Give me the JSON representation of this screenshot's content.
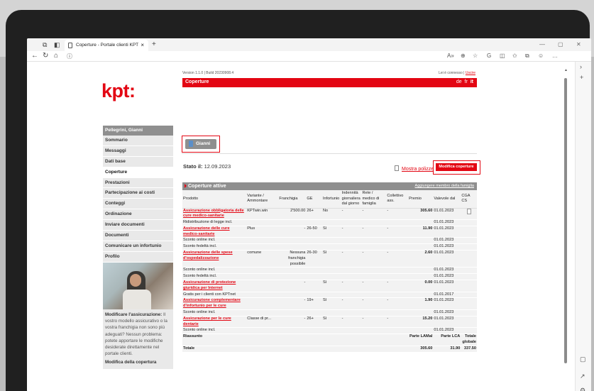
{
  "browser": {
    "tab_title": "Coperture - Portale clienti KPT",
    "tab_close": "×",
    "new_tab": "+",
    "address": ""
  },
  "header": {
    "logo": "kpt:",
    "version": "Version 1.1.0 | Build 20230908.4",
    "logged_in": "Lei è connesso |",
    "logout": "Uscire",
    "page_title": "Coperture",
    "lang_de": "de",
    "lang_fr": "fr",
    "lang_it": "it"
  },
  "sidebar": {
    "user": "Pellegrini, Gianni",
    "items": [
      {
        "label": "Sommario"
      },
      {
        "label": "Messaggi"
      },
      {
        "label": "Dati base"
      },
      {
        "label": "Coperture"
      },
      {
        "label": "Prestazioni"
      },
      {
        "label": "Partecipazione ai costi"
      },
      {
        "label": "Conteggi"
      },
      {
        "label": "Ordinazione"
      },
      {
        "label": "Inviare documenti"
      },
      {
        "label": "Documenti"
      },
      {
        "label": "Comunicare un infortunio"
      },
      {
        "label": "Profilo"
      }
    ],
    "promo_title": "Modificare l'assicurazione:",
    "promo_text": "Il vostro modello assicurativo o la vostra franchigia non sono più adeguati? Nessun problema: potete apportare le modifiche desiderate direttamente nel portale clienti.",
    "promo_link": "Modifica della copertura"
  },
  "main": {
    "person_tab": "Gianni",
    "stato_label": "Stato il:",
    "stato_date": "12.09.2023",
    "mostra_polizze": "Mostra polizze",
    "modifica_button": "Modifica coperture",
    "panel_title": "Coperture attive",
    "add_member": "Aggiungere membro della famiglia"
  },
  "table": {
    "headers": {
      "prodotto": "Prodotto",
      "variante": "Variante / Ammontare",
      "franchigia": "Franchigia",
      "ge": "GE",
      "infortunio": "Infortunio",
      "indennita": "Indennità giornaliera dal giorno",
      "rete": "Rete / medico di famiglia",
      "collettivo": "Collettivo ass.",
      "premio": "Premio",
      "valevole": "Valevole dal",
      "cga": "CGA CS"
    },
    "rows": [
      {
        "prodotto": "Assicurazione obbligatoria delle cure medico-sanitarie",
        "link": true,
        "variante": "KPTwin.win",
        "franchigia": "2'500.00",
        "ge": "26+",
        "infortunio": "No",
        "indennita": "-",
        "rete": "-",
        "collettivo": "-",
        "premio": "305.60",
        "valevole": "01.01.2023",
        "cga": true
      },
      {
        "prodotto": "Ridistribuzione di legge incl.",
        "link": false,
        "variante": "",
        "franchigia": "",
        "ge": "",
        "infortunio": "",
        "indennita": "",
        "rete": "",
        "collettivo": "",
        "premio": "",
        "valevole": "01.01.2023",
        "cga": false
      },
      {
        "prodotto": "Assicurazione delle cure medico-sanitarie",
        "link": true,
        "variante": "Plus",
        "franchigia": "-",
        "ge": "26-50",
        "infortunio": "Sì",
        "indennita": "-",
        "rete": "-",
        "collettivo": "-",
        "premio": "11.90",
        "valevole": "01.01.2023",
        "cga": false
      },
      {
        "prodotto": "Sconto online incl.",
        "link": false,
        "variante": "",
        "franchigia": "",
        "ge": "",
        "infortunio": "",
        "indennita": "",
        "rete": "",
        "collettivo": "",
        "premio": "",
        "valevole": "01.01.2023",
        "cga": false
      },
      {
        "prodotto": "Sconto fedeltà incl.",
        "link": false,
        "variante": "",
        "franchigia": "",
        "ge": "",
        "infortunio": "",
        "indennita": "",
        "rete": "",
        "collettivo": "",
        "premio": "",
        "valevole": "01.01.2023",
        "cga": false
      },
      {
        "prodotto": "Assicurazione delle spese d'ospedalizzazione",
        "link": true,
        "variante": "comune",
        "franchigia": "Nessuna franchigia possibile",
        "ge": "26-30",
        "infortunio": "Sì",
        "indennita": "-",
        "rete": "-",
        "collettivo": "-",
        "premio": "2.60",
        "valevole": "01.01.2023",
        "cga": false
      },
      {
        "prodotto": "Sconto online incl.",
        "link": false,
        "variante": "",
        "franchigia": "",
        "ge": "",
        "infortunio": "",
        "indennita": "",
        "rete": "",
        "collettivo": "",
        "premio": "",
        "valevole": "01.01.2023",
        "cga": false
      },
      {
        "prodotto": "Sconto fedeltà incl.",
        "link": false,
        "variante": "",
        "franchigia": "",
        "ge": "",
        "infortunio": "",
        "indennita": "",
        "rete": "",
        "collettivo": "",
        "premio": "",
        "valevole": "01.01.2023",
        "cga": false
      },
      {
        "prodotto": "Assicurazione di protezione giuridica per Internet",
        "link": true,
        "variante": "",
        "franchigia": "-",
        "ge": "",
        "infortunio": "Sì",
        "indennita": "-",
        "rete": "-",
        "collettivo": "-",
        "premio": "0.00",
        "valevole": "01.01.2023",
        "cga": false
      },
      {
        "prodotto": "Gratis per i clienti con KPTnet",
        "link": false,
        "variante": "",
        "franchigia": "",
        "ge": "",
        "infortunio": "",
        "indennita": "",
        "rete": "",
        "collettivo": "",
        "premio": "",
        "valevole": "01.01.2017",
        "cga": false
      },
      {
        "prodotto": "Assicurazione complementare d'infortunio per le cure",
        "link": true,
        "variante": "",
        "franchigia": "-",
        "ge": "19+",
        "infortunio": "Sì",
        "indennita": "-",
        "rete": "-",
        "collettivo": "-",
        "premio": "1.90",
        "valevole": "01.01.2023",
        "cga": false
      },
      {
        "prodotto": "Sconto online incl.",
        "link": false,
        "variante": "",
        "franchigia": "",
        "ge": "",
        "infortunio": "",
        "indennita": "",
        "rete": "",
        "collettivo": "",
        "premio": "",
        "valevole": "01.01.2023",
        "cga": false
      },
      {
        "prodotto": "Assicurazione per le cure dentarie",
        "link": true,
        "variante": "Classe di pr...",
        "franchigia": "-",
        "ge": "26+",
        "infortunio": "Sì",
        "indennita": "-",
        "rete": "-",
        "collettivo": "-",
        "premio": "15.20",
        "valevole": "01.01.2023",
        "cga": false
      },
      {
        "prodotto": "Sconto online incl.",
        "link": false,
        "variante": "",
        "franchigia": "",
        "ge": "",
        "infortunio": "",
        "indennita": "",
        "rete": "",
        "collettivo": "",
        "premio": "",
        "valevole": "01.01.2023",
        "cga": false
      }
    ],
    "summary": {
      "label": "Riassunto",
      "parte_lamal": "Parte LAMal",
      "parte_lca": "Parte LCA",
      "totale_globale": "Totale globale",
      "totale_label": "Totale",
      "totale_lamal": "305.60",
      "totale_lca": "31.90",
      "totale": "337.50"
    }
  },
  "colors": {
    "brand_red": "#e30613",
    "nav_grey": "#8f8f8f",
    "sidebar_bg": "#e9e9e9"
  }
}
